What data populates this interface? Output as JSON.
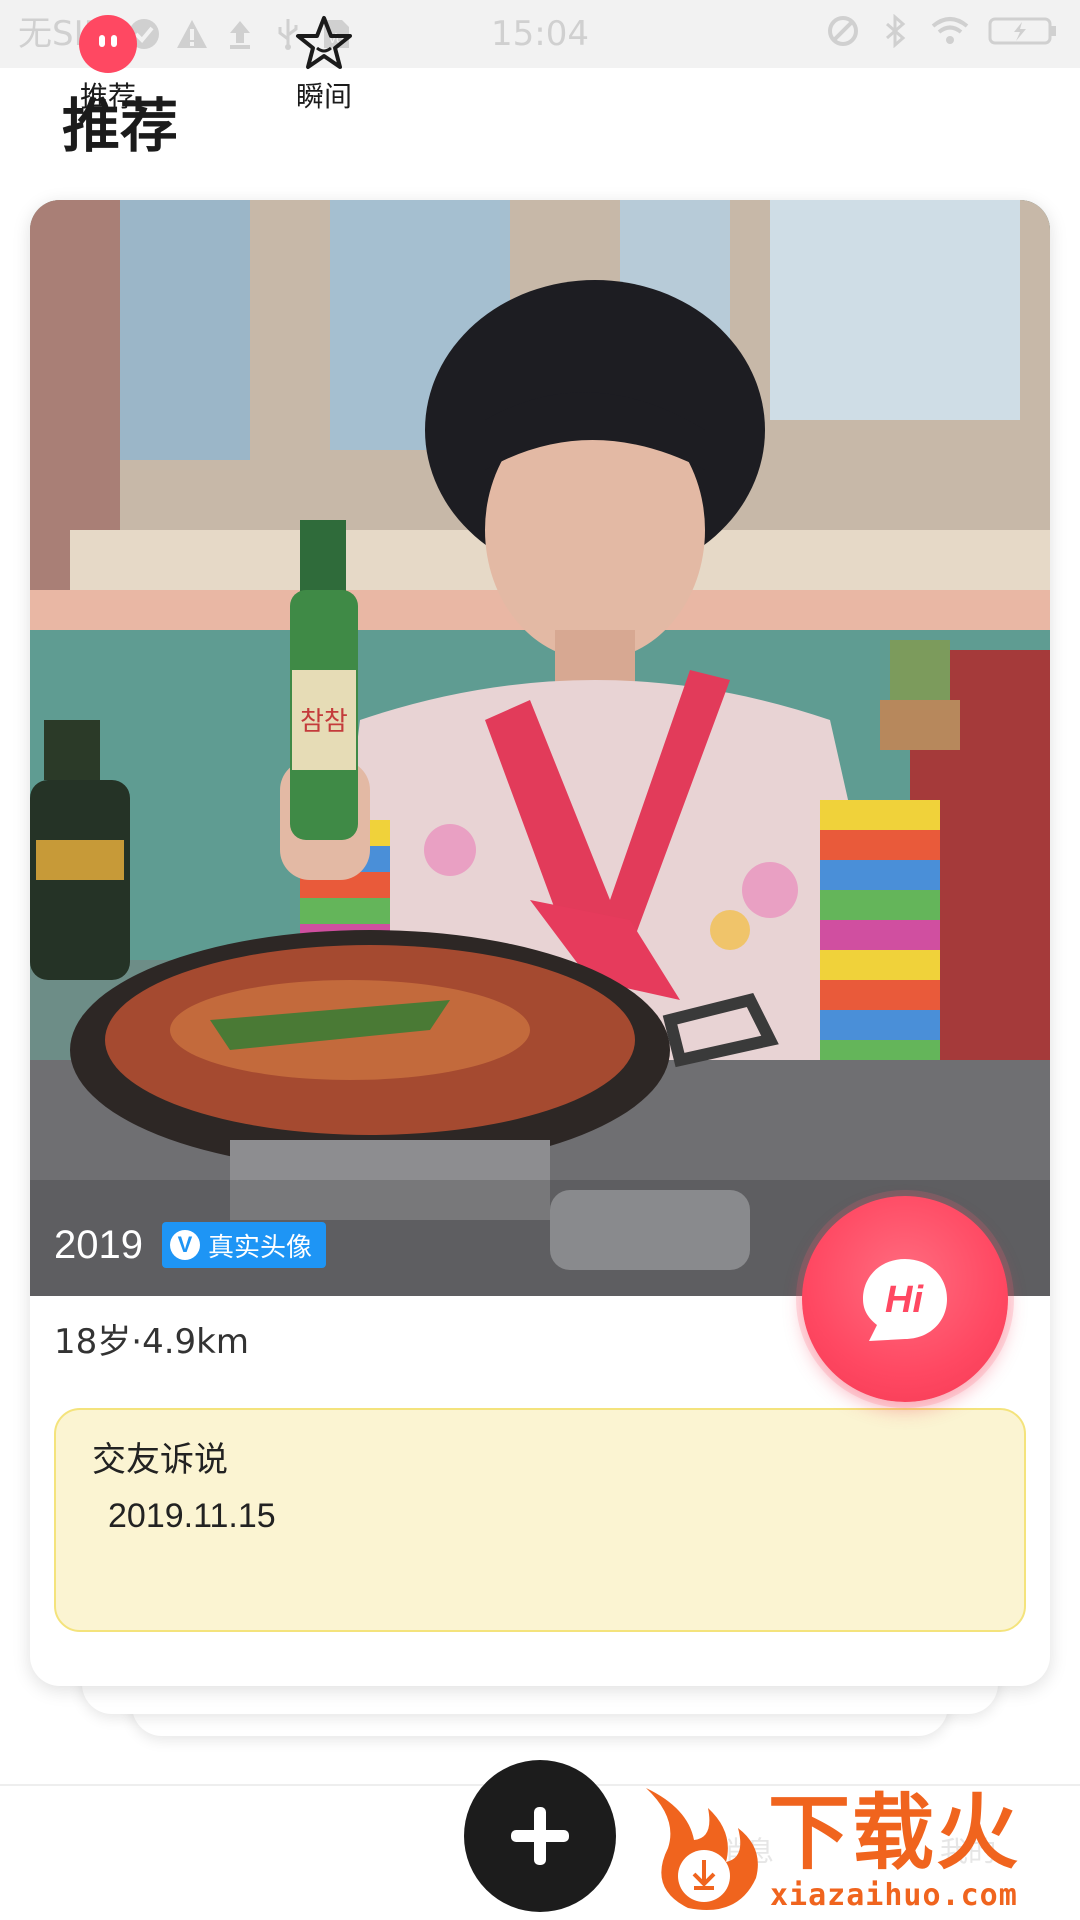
{
  "status_bar": {
    "carrier": "无SIM",
    "time": "15:04",
    "left_icons": [
      "check-circle-icon",
      "warning-icon",
      "upload-icon",
      "usb-icon",
      "sim-icon"
    ],
    "right_icons": [
      "alarm-icon",
      "bluetooth-icon",
      "wifi-icon",
      "battery-charging-icon"
    ]
  },
  "page": {
    "title": "推荐"
  },
  "card": {
    "nickname": "2019",
    "verify_badge": "真实头像",
    "verify_letter": "V",
    "meta": "18岁·4.9km",
    "note_title": "交友诉说",
    "note_date": "2019.11.15",
    "hi_label": "Hi"
  },
  "bottom_nav": {
    "items": [
      {
        "label": "推荐",
        "icon": "face-bubble-icon",
        "active": true
      },
      {
        "label": "瞬间",
        "icon": "star-outline-icon",
        "active": false
      }
    ],
    "add_icon": "plus-icon",
    "ghost_labels": [
      "消息",
      "我的"
    ]
  },
  "watermark": {
    "main": "下载火",
    "sub": "xiazaihuo.com"
  },
  "colors": {
    "accent_red": "#ff4862",
    "badge_blue": "#1e95f5",
    "note_bg": "#fbf4d2",
    "watermark_orange": "#f0641e"
  }
}
